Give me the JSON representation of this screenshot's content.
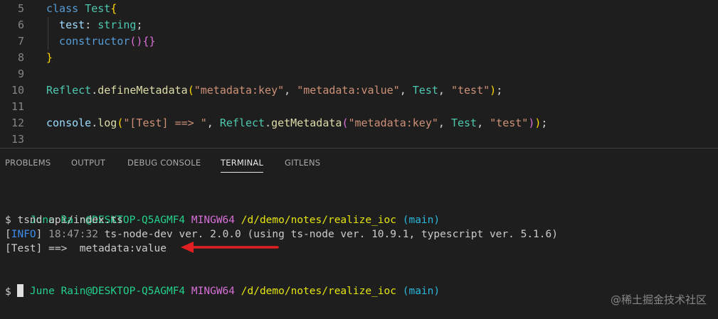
{
  "editor": {
    "lines": [
      {
        "num": "5",
        "tokens": [
          {
            "t": "class ",
            "c": "kw"
          },
          {
            "t": "Test",
            "c": "cls"
          },
          {
            "t": "{",
            "c": "br1"
          }
        ]
      },
      {
        "num": "6",
        "tokens": [
          {
            "t": "  test",
            "c": "prop"
          },
          {
            "t": ": ",
            "c": "pl"
          },
          {
            "t": "string",
            "c": "cls"
          },
          {
            "t": ";",
            "c": "pl"
          }
        ]
      },
      {
        "num": "7",
        "tokens": [
          {
            "t": "  constructor",
            "c": "kw"
          },
          {
            "t": "()",
            "c": "br2"
          },
          {
            "t": "{}",
            "c": "br2"
          }
        ]
      },
      {
        "num": "8",
        "tokens": [
          {
            "t": "}",
            "c": "br1"
          }
        ]
      },
      {
        "num": "9",
        "tokens": []
      },
      {
        "num": "10",
        "tokens": [
          {
            "t": "Reflect",
            "c": "cls"
          },
          {
            "t": ".",
            "c": "pl"
          },
          {
            "t": "defineMetadata",
            "c": "fn"
          },
          {
            "t": "(",
            "c": "br1"
          },
          {
            "t": "\"metadata:key\"",
            "c": "str"
          },
          {
            "t": ", ",
            "c": "pl"
          },
          {
            "t": "\"metadata:value\"",
            "c": "str"
          },
          {
            "t": ", ",
            "c": "pl"
          },
          {
            "t": "Test",
            "c": "cls"
          },
          {
            "t": ", ",
            "c": "pl"
          },
          {
            "t": "\"test\"",
            "c": "str"
          },
          {
            "t": ")",
            "c": "br1"
          },
          {
            "t": ";",
            "c": "pl"
          }
        ]
      },
      {
        "num": "11",
        "tokens": []
      },
      {
        "num": "12",
        "tokens": [
          {
            "t": "console",
            "c": "prop"
          },
          {
            "t": ".",
            "c": "pl"
          },
          {
            "t": "log",
            "c": "fn"
          },
          {
            "t": "(",
            "c": "br1"
          },
          {
            "t": "\"[Test] ==> \"",
            "c": "str"
          },
          {
            "t": ", ",
            "c": "pl"
          },
          {
            "t": "Reflect",
            "c": "cls"
          },
          {
            "t": ".",
            "c": "pl"
          },
          {
            "t": "getMetadata",
            "c": "fn"
          },
          {
            "t": "(",
            "c": "br2"
          },
          {
            "t": "\"metadata:key\"",
            "c": "str"
          },
          {
            "t": ", ",
            "c": "pl"
          },
          {
            "t": "Test",
            "c": "cls"
          },
          {
            "t": ", ",
            "c": "pl"
          },
          {
            "t": "\"test\"",
            "c": "str"
          },
          {
            "t": ")",
            "c": "br2"
          },
          {
            "t": ")",
            "c": "br1"
          },
          {
            "t": ";",
            "c": "pl"
          }
        ]
      },
      {
        "num": "13",
        "tokens": []
      }
    ]
  },
  "panel": {
    "tabs": [
      {
        "label": "PROBLEMS",
        "active": false
      },
      {
        "label": "OUTPUT",
        "active": false
      },
      {
        "label": "DEBUG CONSOLE",
        "active": false
      },
      {
        "label": "TERMINAL",
        "active": true
      },
      {
        "label": "GITLENS",
        "active": false
      }
    ]
  },
  "terminal": {
    "prompt1": {
      "user": "June Rain@DESKTOP-Q5AGMF4",
      "shell": "MINGW64",
      "path": "/d/demo/notes/realize_ioc",
      "branch": "(main)"
    },
    "command": "$ tsnd api/index.ts",
    "info": {
      "bracket_open": "[",
      "tag": "INFO",
      "bracket_close": "]",
      "time": "18:47:32",
      "message": "ts-node-dev ver. 2.0.0 (using ts-node ver. 10.9.1, typescript ver. 5.1.6)"
    },
    "output": "[Test] ==>  metadata:value",
    "prompt2": {
      "user": "June Rain@DESKTOP-Q5AGMF4",
      "shell": "MINGW64",
      "path": "/d/demo/notes/realize_ioc",
      "branch": "(main)"
    },
    "input_prompt": "$"
  },
  "annotation": {
    "arrow_color": "#e02020"
  },
  "watermark": "@稀土掘金技术社区"
}
